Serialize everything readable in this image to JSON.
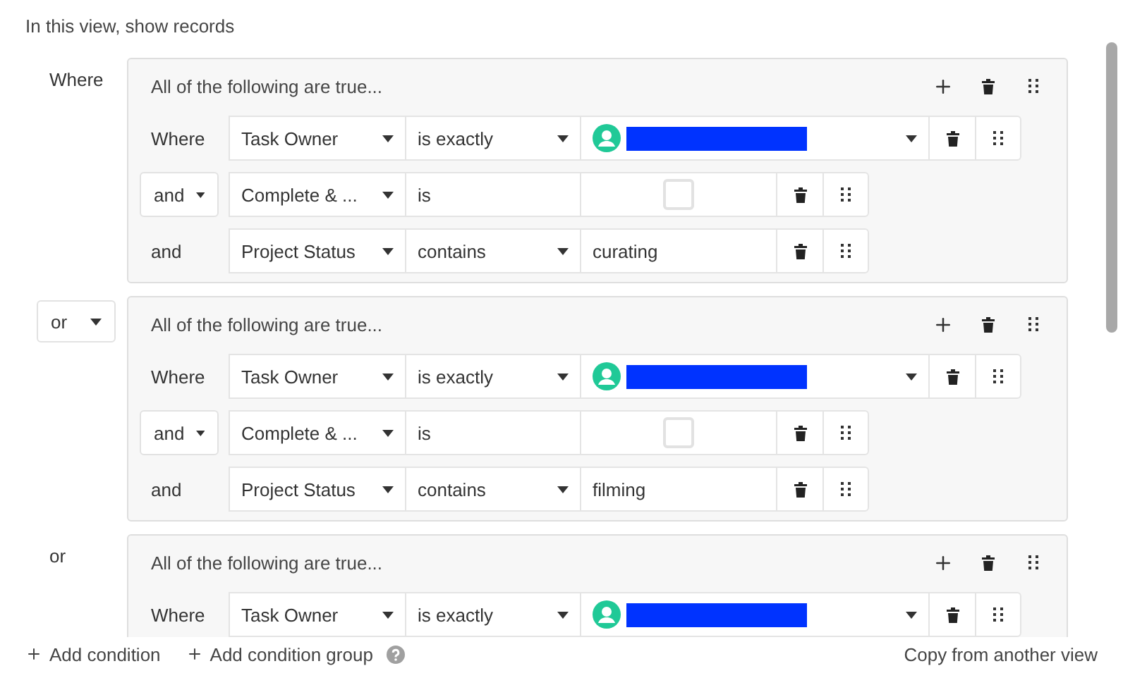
{
  "title": "In this view, show records",
  "groups": [
    {
      "conjunction": {
        "kind": "label",
        "text": "Where"
      },
      "heading": "All of the following are true...",
      "conditions": [
        {
          "conjunction": {
            "kind": "label",
            "text": "Where"
          },
          "field": "Task Owner",
          "operator": {
            "text": "is exactly",
            "menu": true
          },
          "value": {
            "kind": "user"
          }
        },
        {
          "conjunction": {
            "kind": "dropdown",
            "text": "and"
          },
          "field": "Complete & ...",
          "operator": {
            "text": "is",
            "menu": false
          },
          "value": {
            "kind": "checkbox",
            "checked": false
          }
        },
        {
          "conjunction": {
            "kind": "label",
            "text": "and"
          },
          "field": "Project Status",
          "operator": {
            "text": "contains",
            "menu": true
          },
          "value": {
            "kind": "text",
            "text": "curating"
          }
        }
      ]
    },
    {
      "conjunction": {
        "kind": "dropdown",
        "text": "or"
      },
      "heading": "All of the following are true...",
      "conditions": [
        {
          "conjunction": {
            "kind": "label",
            "text": "Where"
          },
          "field": "Task Owner",
          "operator": {
            "text": "is exactly",
            "menu": true
          },
          "value": {
            "kind": "user"
          }
        },
        {
          "conjunction": {
            "kind": "dropdown",
            "text": "and"
          },
          "field": "Complete & ...",
          "operator": {
            "text": "is",
            "menu": false
          },
          "value": {
            "kind": "checkbox",
            "checked": false
          }
        },
        {
          "conjunction": {
            "kind": "label",
            "text": "and"
          },
          "field": "Project Status",
          "operator": {
            "text": "contains",
            "menu": true
          },
          "value": {
            "kind": "text",
            "text": "filming"
          }
        }
      ]
    },
    {
      "conjunction": {
        "kind": "label",
        "text": "or"
      },
      "heading": "All of the following are true...",
      "conditions": [
        {
          "conjunction": {
            "kind": "label",
            "text": "Where"
          },
          "field": "Task Owner",
          "operator": {
            "text": "is exactly",
            "menu": true
          },
          "value": {
            "kind": "user"
          }
        }
      ]
    }
  ],
  "footer": {
    "add_condition": "Add condition",
    "add_group": "Add condition group",
    "copy": "Copy from another view"
  }
}
